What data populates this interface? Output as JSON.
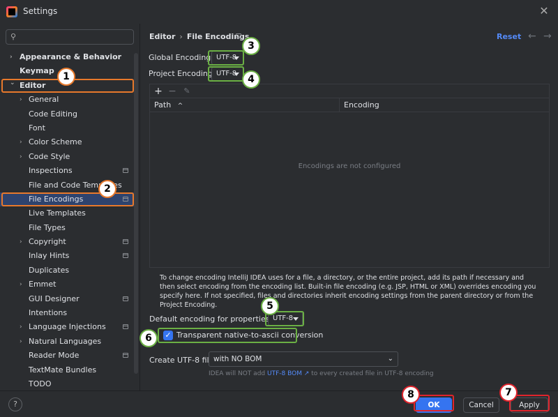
{
  "window": {
    "title": "Settings",
    "close_icon": "close-icon"
  },
  "search": {
    "placeholder": "",
    "value": ""
  },
  "tree": [
    {
      "label": "Appearance & Behavior",
      "level": 0,
      "expandable": true,
      "expanded": false,
      "bold": true,
      "project": false
    },
    {
      "label": "Keymap",
      "level": 0,
      "expandable": false,
      "bold": true,
      "project": false
    },
    {
      "label": "Editor",
      "level": 0,
      "expandable": true,
      "expanded": true,
      "bold": true,
      "project": false
    },
    {
      "label": "General",
      "level": 1,
      "expandable": true,
      "expanded": false,
      "project": false
    },
    {
      "label": "Code Editing",
      "level": 1,
      "expandable": false,
      "project": false
    },
    {
      "label": "Font",
      "level": 1,
      "expandable": false,
      "project": false
    },
    {
      "label": "Color Scheme",
      "level": 1,
      "expandable": true,
      "expanded": false,
      "project": false
    },
    {
      "label": "Code Style",
      "level": 1,
      "expandable": true,
      "expanded": false,
      "project": false
    },
    {
      "label": "Inspections",
      "level": 1,
      "expandable": false,
      "project": true
    },
    {
      "label": "File and Code Templates",
      "level": 1,
      "expandable": false,
      "project": false
    },
    {
      "label": "File Encodings",
      "level": 1,
      "expandable": false,
      "project": true,
      "selected": true
    },
    {
      "label": "Live Templates",
      "level": 1,
      "expandable": false,
      "project": false
    },
    {
      "label": "File Types",
      "level": 1,
      "expandable": false,
      "project": false
    },
    {
      "label": "Copyright",
      "level": 1,
      "expandable": true,
      "expanded": false,
      "project": true
    },
    {
      "label": "Inlay Hints",
      "level": 1,
      "expandable": false,
      "project": true
    },
    {
      "label": "Duplicates",
      "level": 1,
      "expandable": false,
      "project": false
    },
    {
      "label": "Emmet",
      "level": 1,
      "expandable": true,
      "expanded": false,
      "project": false
    },
    {
      "label": "GUI Designer",
      "level": 1,
      "expandable": false,
      "project": true
    },
    {
      "label": "Intentions",
      "level": 1,
      "expandable": false,
      "project": false
    },
    {
      "label": "Language Injections",
      "level": 1,
      "expandable": true,
      "expanded": false,
      "project": true
    },
    {
      "label": "Natural Languages",
      "level": 1,
      "expandable": true,
      "expanded": false,
      "project": false
    },
    {
      "label": "Reader Mode",
      "level": 1,
      "expandable": false,
      "project": true
    },
    {
      "label": "TextMate Bundles",
      "level": 1,
      "expandable": false,
      "project": false
    },
    {
      "label": "TODO",
      "level": 1,
      "expandable": false,
      "project": false
    }
  ],
  "main": {
    "breadcrumb": [
      "Editor",
      "File Encodings"
    ],
    "reset_label": "Reset",
    "global_encoding_label": "Global Encoding:",
    "global_encoding_value": "UTF-8",
    "project_encoding_label": "Project Encoding:",
    "project_encoding_value": "UTF-8",
    "table_headers": [
      "Path",
      "Encoding"
    ],
    "empty_message": "Encodings are not configured",
    "help_text": "To change encoding IntelliJ IDEA uses for a file, a directory, or the entire project, add its path if necessary and then select encoding from the encoding list. Built-in file encoding (e.g. JSP, HTML or XML) overrides encoding you specify here. If not specified, files and directories inherit encoding settings from the parent directory or from the Project Encoding.",
    "properties_label": "Default encoding for properties files:",
    "properties_value": "UTF-8",
    "native_to_ascii_label": "Transparent native-to-ascii conversion",
    "native_to_ascii_checked": true,
    "bom_label": "Create UTF-8 files:",
    "bom_value": "with NO BOM",
    "bom_note_prefix": "IDEA will NOT add",
    "bom_note_link": "UTF-8 BOM ↗",
    "bom_note_suffix": "to every created file in UTF-8 encoding"
  },
  "footer": {
    "ok_label": "OK",
    "cancel_label": "Cancel",
    "apply_label": "Apply",
    "help_label": "?"
  },
  "annotations": [
    "1",
    "2",
    "3",
    "4",
    "5",
    "6",
    "7",
    "8"
  ],
  "colors": {
    "accent": "#3574f0",
    "highlight_orange": "#e8792b",
    "highlight_green": "#6bb044",
    "highlight_red": "#e0242c",
    "link": "#548af7"
  }
}
